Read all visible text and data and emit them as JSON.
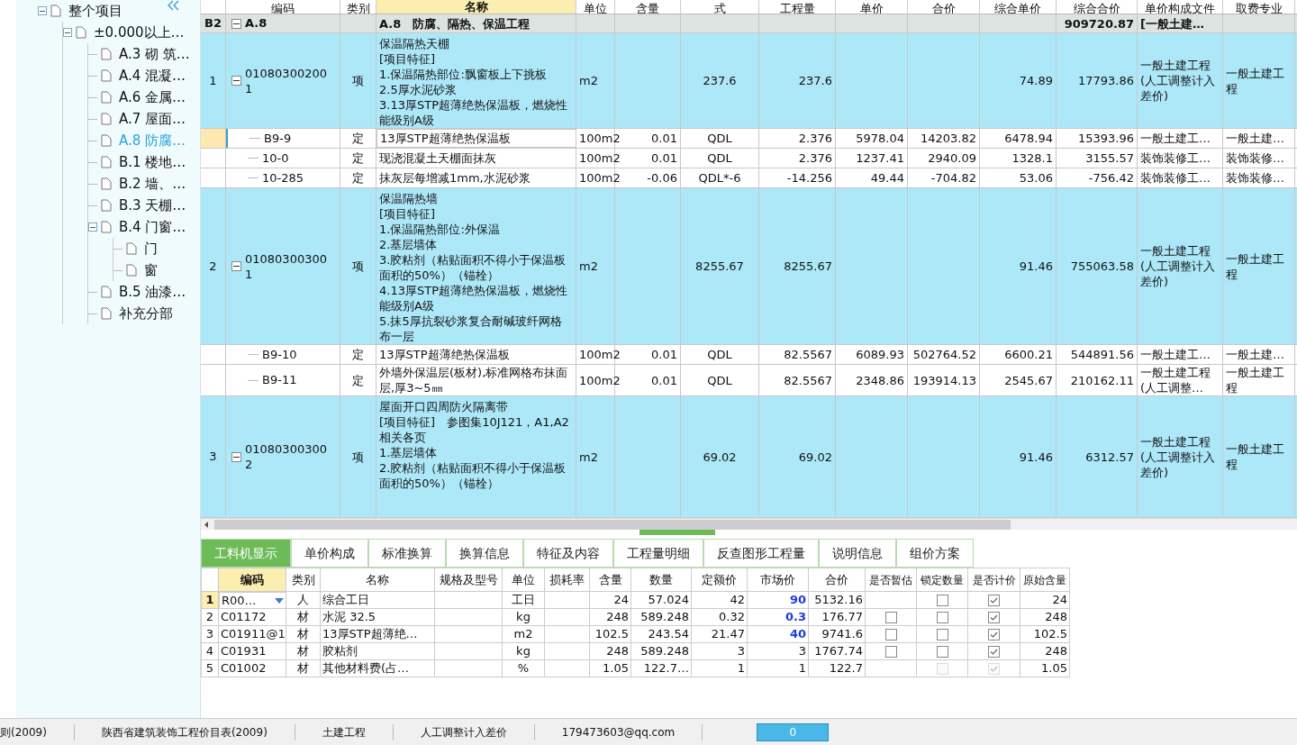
{
  "sidebar": {
    "tree": [
      {
        "label": "整个项目",
        "selected": false,
        "expanded": true,
        "children": [
          {
            "label": "±0.000以上…",
            "selected": false,
            "expanded": true,
            "children": [
              {
                "label": "A.3  砌 筑…",
                "selected": false
              },
              {
                "label": "A.4  混凝…",
                "selected": false
              },
              {
                "label": "A.6  金属…",
                "selected": false
              },
              {
                "label": "A.7  屋面…",
                "selected": false
              },
              {
                "label": "A.8  防腐…",
                "selected": true
              },
              {
                "label": "B.1  楼地…",
                "selected": false
              },
              {
                "label": "B.2  墙、…",
                "selected": false
              },
              {
                "label": "B.3  天棚…",
                "selected": false
              },
              {
                "label": "B.4  门窗…",
                "selected": false,
                "expanded": true,
                "children": [
                  {
                    "label": "门",
                    "selected": false
                  },
                  {
                    "label": "窗",
                    "selected": false
                  }
                ]
              },
              {
                "label": "B.5  油漆…",
                "selected": false
              },
              {
                "label": "补充分部",
                "selected": false
              }
            ]
          }
        ]
      }
    ]
  },
  "main_table": {
    "columns": [
      "编码",
      "类别",
      "名称",
      "单位",
      "含量",
      "式",
      "工程量",
      "单价",
      "合价",
      "综合单价",
      "综合合价",
      "单价构成文件",
      "取费专业"
    ],
    "rows": [
      {
        "kind": "section",
        "selected": false,
        "expanded": true,
        "num": "B2",
        "code": "A.8",
        "name": [
          "A.8　防腐、隔热、保温工程"
        ],
        "all_in_total": "909720.87",
        "price_file": "[一般土建…"
      },
      {
        "kind": "item",
        "selected": false,
        "expanded": true,
        "num": "1",
        "code": "010803002001",
        "type": "项",
        "name": [
          "保温隔热天棚",
          "[项目特征]",
          "1.保温隔热部位:飘窗板上下挑板",
          "2.5厚水泥砂浆",
          "3.13厚STP超薄绝热保温板，燃烧性能级别A级"
        ],
        "unit": "m2",
        "formula": "237.6",
        "quantity": "237.6",
        "all_in_unit_price": "74.89",
        "all_in_total": "17793.86",
        "price_file": "一般土建工程(人工调整计入差价)",
        "fee_category": "一般土建工程"
      },
      {
        "kind": "norm",
        "selected": true,
        "code": "B9-9",
        "type": "定",
        "name": [
          "13厚STP超薄绝热保温板"
        ],
        "unit": "100m2",
        "qty_ratio": "0.01",
        "formula": "QDL",
        "quantity": "2.376",
        "unit_price": "5978.04",
        "total_price": "14203.82",
        "all_in_unit_price": "6478.94",
        "all_in_total": "15393.96",
        "price_file": "一般土建工…",
        "fee_category": "一般土建…"
      },
      {
        "kind": "norm",
        "selected": false,
        "code": "10-0",
        "type": "定",
        "name": [
          "现浇混凝土天棚面抹灰"
        ],
        "unit": "100m2",
        "qty_ratio": "0.01",
        "formula": "QDL",
        "quantity": "2.376",
        "unit_price": "1237.41",
        "total_price": "2940.09",
        "all_in_unit_price": "1328.1",
        "all_in_total": "3155.57",
        "price_file": "装饰装修工…",
        "fee_category": "装饰装修…"
      },
      {
        "kind": "norm",
        "selected": false,
        "code": "10-285",
        "type": "定",
        "name": [
          "抹灰层每增减1mm,水泥砂浆"
        ],
        "unit": "100m2",
        "qty_ratio": "-0.06",
        "formula": "QDL*-6",
        "quantity": "-14.256",
        "unit_price": "49.44",
        "total_price": "-704.82",
        "all_in_unit_price": "53.06",
        "all_in_total": "-756.42",
        "price_file": "装饰装修工…",
        "fee_category": "装饰装修…"
      },
      {
        "kind": "item",
        "selected": false,
        "expanded": true,
        "num": "2",
        "code": "010803003001",
        "type": "项",
        "name": [
          "保温隔热墙",
          "[项目特征]",
          "1.保温隔热部位:外保温",
          "2.基层墙体",
          "3.胶粘剂（粘贴面积不得小于保温板面积的50%）（锚栓）",
          "4.13厚STP超薄绝热保温板，燃烧性能级别A级",
          "5.抹5厚抗裂砂浆复合耐碱玻纤网格布一层"
        ],
        "unit": "m2",
        "formula": "8255.67",
        "quantity": "8255.67",
        "all_in_unit_price": "91.46",
        "all_in_total": "755063.58",
        "price_file": "一般土建工程(人工调整计入差价)",
        "fee_category": "一般土建工程"
      },
      {
        "kind": "norm",
        "selected": false,
        "code": "B9-10",
        "type": "定",
        "name": [
          "13厚STP超薄绝热保温板"
        ],
        "unit": "100m2",
        "qty_ratio": "0.01",
        "formula": "QDL",
        "quantity": "82.5567",
        "unit_price": "6089.93",
        "total_price": "502764.52",
        "all_in_unit_price": "6600.21",
        "all_in_total": "544891.56",
        "price_file": "一般土建工…",
        "fee_category": "一般土建…"
      },
      {
        "kind": "norm",
        "selected": false,
        "code": "B9-11",
        "type": "定",
        "name": [
          "外墙外保温层(板材),标准网格布抹面层,厚3~5㎜"
        ],
        "unit": "100m2",
        "qty_ratio": "0.01",
        "formula": "QDL",
        "quantity": "82.5567",
        "unit_price": "2348.86",
        "total_price": "193914.13",
        "all_in_unit_price": "2545.67",
        "all_in_total": "210162.11",
        "price_file": "一般土建工程(人工调整…",
        "fee_category": "一般土建工程"
      },
      {
        "kind": "item",
        "selected": false,
        "expanded": true,
        "num": "3",
        "code": "010803003002",
        "type": "项",
        "name": [
          "屋面开口四周防火隔离带",
          "[项目特征]　参图集10J121，A1,A2相关各页",
          "1.基层墙体",
          "2.胶粘剂（粘贴面积不得小于保温板面积的50%）（锚栓）"
        ],
        "unit": "m2",
        "formula": "69.02",
        "quantity": "69.02",
        "all_in_unit_price": "91.46",
        "all_in_total": "6312.57",
        "price_file": "一般土建工程(人工调整计入差价)",
        "fee_category": "一般土建工程"
      }
    ]
  },
  "tabs": [
    {
      "label": "工料机显示",
      "selected": true
    },
    {
      "label": "单价构成",
      "selected": false
    },
    {
      "label": "标准换算",
      "selected": false
    },
    {
      "label": "换算信息",
      "selected": false
    },
    {
      "label": "特征及内容",
      "selected": false
    },
    {
      "label": "工程量明细",
      "selected": false
    },
    {
      "label": "反查图形工程量",
      "selected": false
    },
    {
      "label": "说明信息",
      "selected": false
    },
    {
      "label": "组价方案",
      "selected": false
    }
  ],
  "resource_table": {
    "columns": [
      "编码",
      "类别",
      "名称",
      "规格及型号",
      "单位",
      "损耗率",
      "含量",
      "数量",
      "定额价",
      "市场价",
      "合价",
      "是否暂估",
      "锁定数量",
      "是否计价",
      "原始含量"
    ],
    "rows": [
      {
        "num": "1",
        "selected": true,
        "code": "R00…",
        "type": "人",
        "name": "综合工日",
        "unit": "工日",
        "ratio": "24",
        "amount": "57.024",
        "quota_price": "42",
        "market_price": "90",
        "adjusted": true,
        "total": "5132.16",
        "locked": {
          "checked": false,
          "disabled": false
        },
        "priced": {
          "checked": true,
          "disabled": false
        },
        "original": "24"
      },
      {
        "num": "2",
        "selected": false,
        "code": "C01172",
        "type": "材",
        "name": "水泥 32.5",
        "unit": "kg",
        "ratio": "248",
        "amount": "589.248",
        "quota_price": "0.32",
        "market_price": "0.3",
        "adjusted": true,
        "total": "176.77",
        "estimate": {
          "checked": false,
          "disabled": false
        },
        "locked": {
          "checked": false,
          "disabled": false
        },
        "priced": {
          "checked": true,
          "disabled": false
        },
        "original": "248"
      },
      {
        "num": "3",
        "selected": false,
        "code": "C01911@1",
        "type": "材",
        "name": "13厚STP超薄绝…",
        "unit": "m2",
        "ratio": "102.5",
        "amount": "243.54",
        "quota_price": "21.47",
        "market_price": "40",
        "adjusted": true,
        "total": "9741.6",
        "estimate": {
          "checked": false,
          "disabled": false
        },
        "locked": {
          "checked": false,
          "disabled": false
        },
        "priced": {
          "checked": true,
          "disabled": false
        },
        "original": "102.5"
      },
      {
        "num": "4",
        "selected": false,
        "code": "C01931",
        "type": "材",
        "name": "胶粘剂",
        "unit": "kg",
        "ratio": "248",
        "amount": "589.248",
        "quota_price": "3",
        "market_price": "3",
        "adjusted": false,
        "total": "1767.74",
        "estimate": {
          "checked": false,
          "disabled": false
        },
        "locked": {
          "checked": false,
          "disabled": false
        },
        "priced": {
          "checked": true,
          "disabled": false
        },
        "original": "248"
      },
      {
        "num": "5",
        "selected": false,
        "code": "C01002",
        "type": "材",
        "name": "其他材料费(占…",
        "unit": "%",
        "ratio": "1.05",
        "amount": "122.7…",
        "quota_price": "1",
        "market_price": "1",
        "adjusted": false,
        "total": "122.7",
        "locked": {
          "checked": false,
          "disabled": true
        },
        "priced": {
          "checked": true,
          "disabled": true
        },
        "original": "1.05"
      }
    ]
  },
  "status_bar": {
    "items": [
      "则(2009)",
      "陕西省建筑装饰工程价目表(2009)",
      "土建工程",
      "人工调整计入差价",
      "179473603@qq.com"
    ],
    "counter": "0"
  }
}
